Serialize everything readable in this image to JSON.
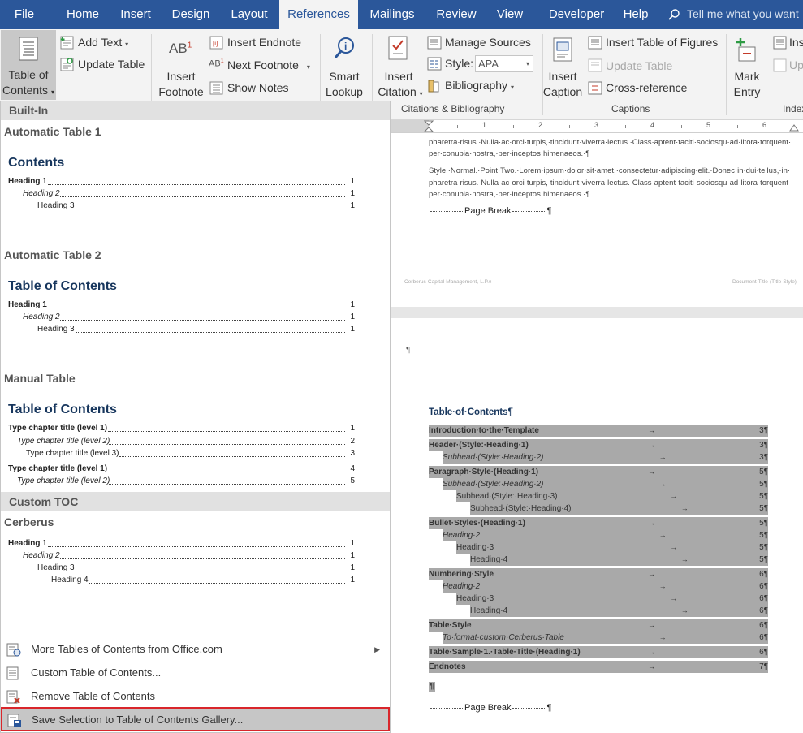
{
  "tabs": [
    {
      "label": "File"
    },
    {
      "label": "Home"
    },
    {
      "label": "Insert"
    },
    {
      "label": "Design"
    },
    {
      "label": "Layout"
    },
    {
      "label": "References"
    },
    {
      "label": "Mailings"
    },
    {
      "label": "Review"
    },
    {
      "label": "View"
    },
    {
      "label": "Developer"
    },
    {
      "label": "Help"
    }
  ],
  "active_tab": "References",
  "tell_me": {
    "placeholder": "Tell me what you want"
  },
  "ribbon": {
    "toc": {
      "line1": "Table of",
      "line2": "Contents"
    },
    "add_text": "Add Text",
    "update_table": "Update Table",
    "insert_footnote": {
      "line1": "Insert",
      "line2": "Footnote"
    },
    "footnote_icon_text": "AB",
    "footnote_icon_sup": "1",
    "insert_endnote": "Insert Endnote",
    "next_footnote": "Next Footnote",
    "show_notes": "Show Notes",
    "smart_lookup": {
      "line1": "Smart",
      "line2": "Lookup"
    },
    "insert_citation": {
      "line1": "Insert",
      "line2": "Citation"
    },
    "manage_sources": "Manage Sources",
    "style_label": "Style:",
    "style_value": "APA",
    "bibliography": "Bibliography",
    "citations_group": "Citations & Bibliography",
    "insert_caption": {
      "line1": "Insert",
      "line2": "Caption"
    },
    "insert_table_of_figures": "Insert Table of Figures",
    "update_table_figures": "Update Table",
    "cross_reference": "Cross-reference",
    "captions_group": "Captions",
    "mark_entry": {
      "line1": "Mark",
      "line2": "Entry"
    },
    "insert_index": "Ins",
    "update_index": "Up",
    "index_group": "Index"
  },
  "gallery": {
    "builtin_header": "Built-In",
    "auto1": {
      "name": "Automatic Table 1",
      "title": "Contents",
      "lines": [
        {
          "text": "Heading 1",
          "num": "1"
        },
        {
          "text": "Heading 2",
          "num": "1"
        },
        {
          "text": "Heading 3",
          "num": "1"
        }
      ]
    },
    "auto2": {
      "name": "Automatic Table 2",
      "title": "Table of Contents",
      "lines": [
        {
          "text": "Heading 1",
          "num": "1"
        },
        {
          "text": "Heading 2",
          "num": "1"
        },
        {
          "text": "Heading 3",
          "num": "1"
        }
      ]
    },
    "manual": {
      "name": "Manual Table",
      "title": "Table of Contents",
      "lines": [
        {
          "text": "Type chapter title (level 1)",
          "num": "1"
        },
        {
          "text": "Type chapter title (level 2)",
          "num": "2"
        },
        {
          "text": "Type chapter title (level 3)",
          "num": "3"
        },
        {
          "text": "Type chapter title (level 1)",
          "num": "4"
        },
        {
          "text": "Type chapter title (level 2)",
          "num": "5"
        }
      ]
    },
    "custom_header": "Custom TOC",
    "custom": {
      "name": "Cerberus",
      "lines": [
        {
          "text": "Heading 1",
          "num": "1"
        },
        {
          "text": "Heading 2",
          "num": "1"
        },
        {
          "text": "Heading 3",
          "num": "1"
        },
        {
          "text": "Heading 4",
          "num": "1"
        }
      ]
    }
  },
  "menu": {
    "more_tables": "More Tables of Contents from Office.com",
    "custom_toc": "Custom Table of Contents...",
    "remove_toc": "Remove Table of Contents",
    "save_selection": "Save Selection to Table of Contents Gallery..."
  },
  "ruler_ticks": [
    "1",
    "2",
    "3",
    "4",
    "5",
    "6"
  ],
  "document": {
    "para1": [
      "pharetra·risus.·Nulla·ac·orci·turpis,·tincidunt·viverra·lectus.·Class·aptent·taciti·sociosqu·ad·litora·torquent·",
      "per·conubia·nostra,·per·inceptos·himenaeos.·¶"
    ],
    "para2": [
      "Style:·Normal.·Point·Two.·Lorem·ipsum·dolor·sit·amet,·consectetur·adipiscing·elit.·Donec·in·dui·tellus,·in·",
      "pharetra·risus.·Nulla·ac·orci·turpis,·tincidunt·viverra·lectus.·Class·aptent·taciti·sociosqu·ad·litora·torquent·",
      "per·conubia·nostra,·per·inceptos·himenaeos.·¶"
    ],
    "page_break": "Page Break",
    "pilcrow": "¶",
    "footer_left": "Cerberus·Capital·Management,·L.P.¤",
    "footer_right": "Document·Title·(Title·Style)",
    "toc_title": "Table·of·Contents¶",
    "toc_entries": [
      {
        "text": "Introduction·to·the·Template",
        "page": "3¶",
        "level": 1,
        "bold": true
      },
      {
        "text": "Header·(Style:·Heading·1)",
        "page": "3¶",
        "level": 1,
        "bold": true
      },
      {
        "text": "Subhead·(Style:·Heading·2)",
        "page": "3¶",
        "level": 2,
        "italic": true
      },
      {
        "text": "Paragraph·Style·(Heading·1)",
        "page": "5¶",
        "level": 1,
        "bold": true
      },
      {
        "text": "Subhead·(Style:·Heading·2)",
        "page": "5¶",
        "level": 2,
        "italic": true
      },
      {
        "text": "Subhead·(Style:·Heading·3)",
        "page": "5¶",
        "level": 3
      },
      {
        "text": "Subhead·(Style:·Heading·4)",
        "page": "5¶",
        "level": 4
      },
      {
        "text": "Bullet·Styles·(Heading·1)",
        "page": "5¶",
        "level": 1,
        "bold": true
      },
      {
        "text": "Heading·2",
        "page": "5¶",
        "level": 2,
        "italic": true
      },
      {
        "text": "Heading·3",
        "page": "5¶",
        "level": 3
      },
      {
        "text": "Heading·4",
        "page": "5¶",
        "level": 4
      },
      {
        "text": "Numbering·Style",
        "page": "6¶",
        "level": 1,
        "bold": true
      },
      {
        "text": "Heading·2",
        "page": "6¶",
        "level": 2,
        "italic": true
      },
      {
        "text": "Heading·3",
        "page": "6¶",
        "level": 3
      },
      {
        "text": "Heading·4",
        "page": "6¶",
        "level": 4
      },
      {
        "text": "Table·Style",
        "page": "6¶",
        "level": 1,
        "bold": true
      },
      {
        "text": "To·format·custom·Cerberus·Table",
        "page": "6¶",
        "level": 2,
        "italic": true
      },
      {
        "text": "Table·Sample·1.·Table·Title·(Heading·1)",
        "page": "6¶",
        "level": 1,
        "bold": true
      },
      {
        "text": "Endnotes",
        "page": "7¶",
        "level": 1,
        "bold": true
      }
    ]
  }
}
